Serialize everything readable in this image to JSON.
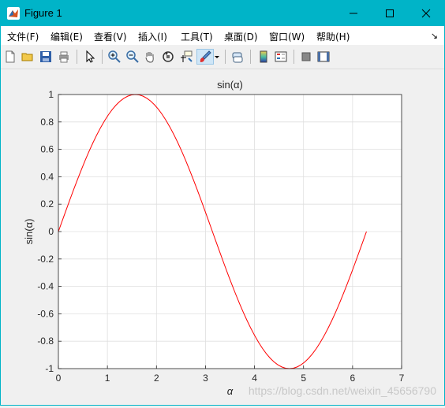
{
  "window": {
    "title": "Figure 1"
  },
  "menubar": {
    "items": [
      {
        "label": "文件(F)"
      },
      {
        "label": "编辑(E)"
      },
      {
        "label": "查看(V)"
      },
      {
        "label": "插入(I)"
      },
      {
        "label": "工具(T)"
      },
      {
        "label": "桌面(D)"
      },
      {
        "label": "窗口(W)"
      },
      {
        "label": "帮助(H)"
      }
    ],
    "overflow_icon": "dock-arrow-icon"
  },
  "toolbar": {
    "icons": [
      "new-figure-icon",
      "open-file-icon",
      "save-icon",
      "print-icon",
      "pointer-icon",
      "zoom-in-icon",
      "zoom-out-icon",
      "pan-icon",
      "rotate-3d-icon",
      "data-cursor-icon",
      "brush-icon",
      "brush-dropdown-icon",
      "link-plot-icon",
      "colorbar-icon",
      "legend-icon",
      "hide-plot-tools-icon",
      "show-plot-tools-icon"
    ]
  },
  "chart_data": {
    "type": "line",
    "title": "sin(α)",
    "xlabel": "α",
    "ylabel": "sin(α)",
    "xlim": [
      0,
      7
    ],
    "ylim": [
      -1,
      1
    ],
    "xticks": [
      "0",
      "1",
      "2",
      "3",
      "4",
      "5",
      "6",
      "7"
    ],
    "yticks": [
      "-1",
      "-0.8",
      "-0.6",
      "-0.4",
      "-0.2",
      "0",
      "0.2",
      "0.4",
      "0.6",
      "0.8",
      "1"
    ],
    "grid": true,
    "series": [
      {
        "color": "#ff0000",
        "function": "sin",
        "x_range": [
          0,
          6.2832
        ]
      }
    ]
  },
  "watermark": "https://blog.csdn.net/weixin_45656790"
}
